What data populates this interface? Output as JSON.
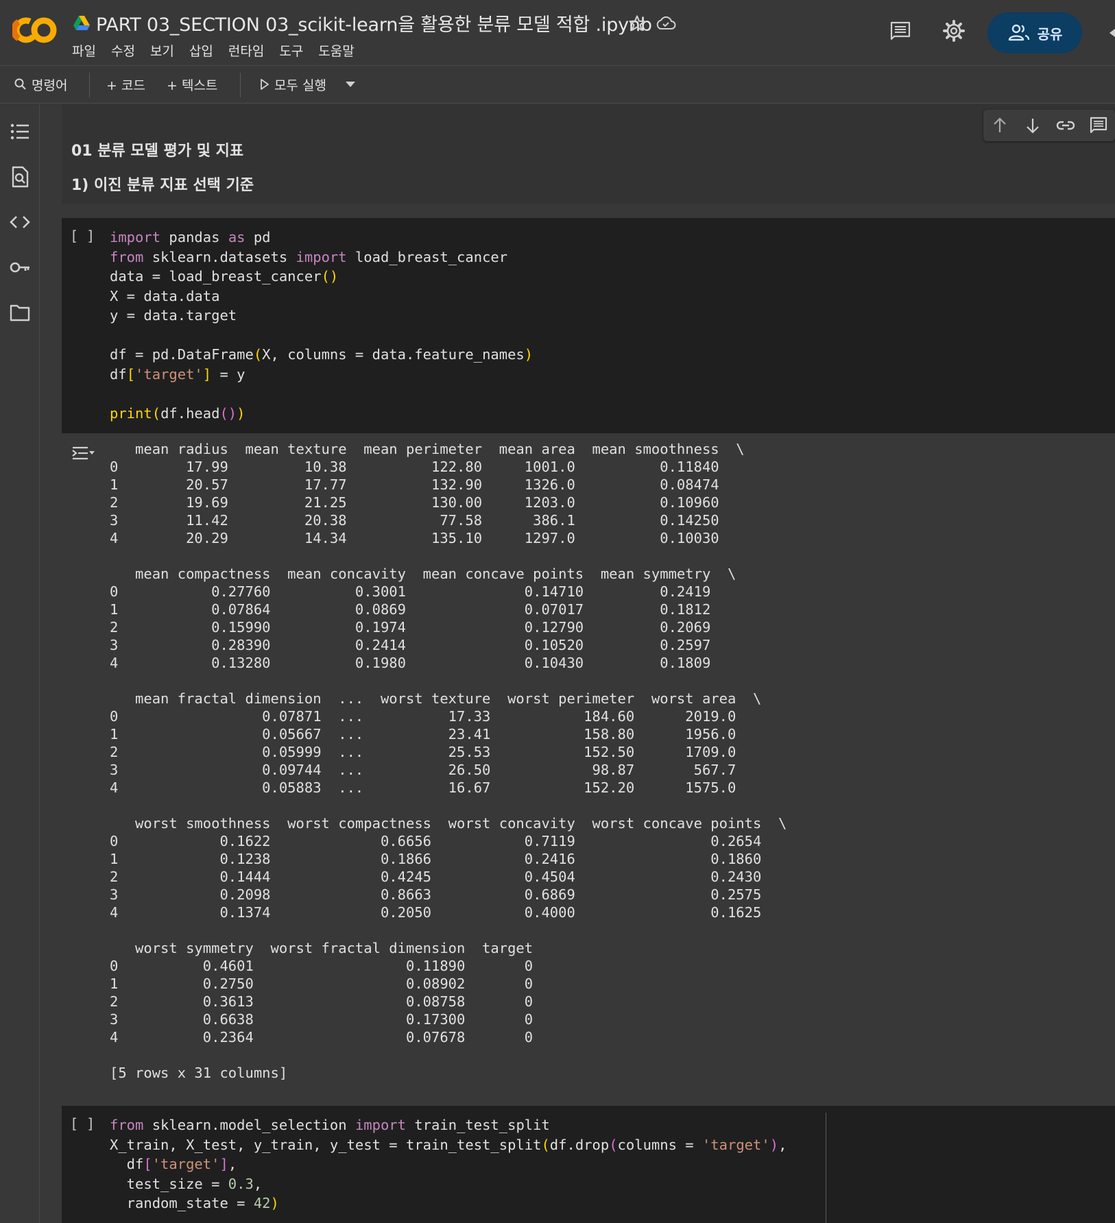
{
  "header": {
    "title": "PART 03_SECTION 03_scikit-learn을 활용한 분류 모델 적합 .ipynb",
    "share_label": "공유"
  },
  "menu": [
    "파일",
    "수정",
    "보기",
    "삽입",
    "런타임",
    "도구",
    "도움말"
  ],
  "toolbar": {
    "commands_label": "명령어",
    "add_code_label": "+ 코드",
    "add_text_label": "+ 텍스트",
    "run_all_label": "모두 실행"
  },
  "icons": {
    "logo": "colab-logo",
    "drive": "google-drive-icon",
    "star": "star-icon",
    "cloud": "cloud-icon",
    "comment": "comment-icon",
    "settings": "gear-icon",
    "share": "people-icon",
    "sidebar": [
      "toc-icon",
      "find-icon",
      "code-snippets-icon",
      "secrets-key-icon",
      "folder-icon"
    ],
    "cell_tools": [
      "arrow-up-icon",
      "arrow-down-icon",
      "link-icon",
      "comment-icon"
    ]
  },
  "colors": {
    "background": "#383838",
    "code_background": "#1f1f1f",
    "share_button": "#0c3d63",
    "logo_orange": "#f9ab00",
    "logo_dark_orange": "#e8710a"
  },
  "text_cell": {
    "heading1": "01 분류 모델 평가 및 지표",
    "heading2": "1) 이진 분류 지표 선택 기준"
  },
  "code_cell_1": {
    "run_indicator": "[ ]",
    "source": "import pandas as pd\nfrom sklearn.datasets import load_breast_cancer\ndata = load_breast_cancer()\nX = data.data\ny = data.target\n\ndf = pd.DataFrame(X, columns = data.feature_names)\ndf['target'] = y\n\nprint(df.head())"
  },
  "output_1": {
    "text": "   mean radius  mean texture  mean perimeter  mean area  mean smoothness  \\\n0        17.99         10.38          122.80     1001.0          0.11840   \n1        20.57         17.77          132.90     1326.0          0.08474   \n2        19.69         21.25          130.00     1203.0          0.10960   \n3        11.42         20.38           77.58      386.1          0.14250   \n4        20.29         14.34          135.10     1297.0          0.10030   \n\n   mean compactness  mean concavity  mean concave points  mean symmetry  \\\n0           0.27760          0.3001              0.14710         0.2419   \n1           0.07864          0.0869              0.07017         0.1812   \n2           0.15990          0.1974              0.12790         0.2069   \n3           0.28390          0.2414              0.10520         0.2597   \n4           0.13280          0.1980              0.10430         0.1809   \n\n   mean fractal dimension  ...  worst texture  worst perimeter  worst area  \\\n0                 0.07871  ...          17.33           184.60      2019.0   \n1                 0.05667  ...          23.41           158.80      1956.0   \n2                 0.05999  ...          25.53           152.50      1709.0   \n3                 0.09744  ...          26.50            98.87       567.7   \n4                 0.05883  ...          16.67           152.20      1575.0   \n\n   worst smoothness  worst compactness  worst concavity  worst concave points  \\\n0            0.1622             0.6656           0.7119                0.2654   \n1            0.1238             0.1866           0.2416                0.1860   \n2            0.1444             0.4245           0.4504                0.2430   \n3            0.2098             0.8663           0.6869                0.2575   \n4            0.1374             0.2050           0.4000                0.1625   \n\n   worst symmetry  worst fractal dimension  target  \n0          0.4601                  0.11890       0  \n1          0.2750                  0.08902       0  \n2          0.3613                  0.08758       0  \n3          0.6638                  0.17300       0  \n4          0.2364                  0.07678       0  \n\n[5 rows x 31 columns]"
  },
  "code_cell_2": {
    "run_indicator": "[ ]",
    "source": "from sklearn.model_selection import train_test_split\nX_train, X_test, y_train, y_test = train_test_split(df.drop(columns = 'target'),\n  df['target'],\n  test_size = 0.3,\n  random_state = 42)"
  }
}
